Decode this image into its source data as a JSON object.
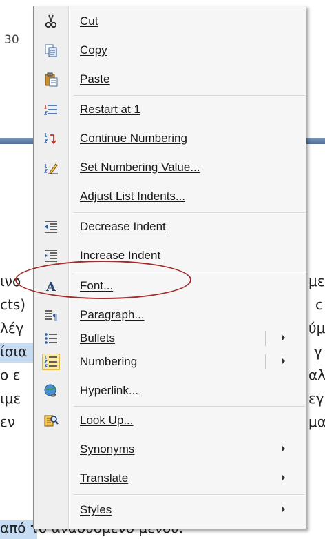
{
  "document": {
    "fragments": [
      {
        "id": "frag-30",
        "text": "30"
      },
      {
        "id": "frag-1",
        "text": "ινο"
      },
      {
        "id": "frag-2",
        "text": "cts)"
      },
      {
        "id": "frag-3",
        "text": "λέγ"
      },
      {
        "id": "frag-4",
        "text": "ίσια"
      },
      {
        "id": "frag-5",
        "text": "ο ε"
      },
      {
        "id": "frag-6",
        "text": "ιμε"
      },
      {
        "id": "frag-7",
        "text": "εν"
      },
      {
        "id": "frag-r1",
        "text": "με"
      },
      {
        "id": "frag-r2",
        "text": "c"
      },
      {
        "id": "frag-r3",
        "text": "ύμ"
      },
      {
        "id": "frag-r4",
        "text": "γ"
      },
      {
        "id": "frag-r5",
        "text": "αλ"
      },
      {
        "id": "frag-r6",
        "text": "εγ"
      },
      {
        "id": "frag-r7",
        "text": "μα"
      },
      {
        "id": "frag-bottom",
        "text": "από το αναδυόμενο μενού."
      }
    ]
  },
  "context_menu": {
    "items": [
      {
        "label": "Cut",
        "icon": "scissors-icon"
      },
      {
        "label": "Copy",
        "icon": "copy-icon"
      },
      {
        "label": "Paste",
        "icon": "paste-icon"
      },
      {
        "label": "Restart at 1",
        "icon": "restart-numbering-icon"
      },
      {
        "label": "Continue Numbering",
        "icon": "continue-numbering-icon"
      },
      {
        "label": "Set Numbering Value...",
        "icon": "set-numbering-value-icon"
      },
      {
        "label": "Adjust List Indents...",
        "icon": ""
      },
      {
        "label": "Decrease Indent",
        "icon": "decrease-indent-icon"
      },
      {
        "label": "Increase Indent",
        "icon": "increase-indent-icon"
      },
      {
        "label": "Font...",
        "icon": "font-icon"
      },
      {
        "label": "Paragraph...",
        "icon": "paragraph-icon"
      },
      {
        "label": "Bullets",
        "icon": "bullets-icon",
        "submenu": true
      },
      {
        "label": "Numbering",
        "icon": "numbering-icon",
        "submenu": true
      },
      {
        "label": "Hyperlink...",
        "icon": "hyperlink-icon"
      },
      {
        "label": "Look Up...",
        "icon": "look-up-icon"
      },
      {
        "label": "Synonyms",
        "icon": "",
        "submenu": true
      },
      {
        "label": "Translate",
        "icon": "",
        "submenu": true
      },
      {
        "label": "Styles",
        "icon": "",
        "submenu": true
      }
    ]
  },
  "colors": {
    "annotation_oval": "#a52a2a",
    "menu_background": "#f6f6f6",
    "gutter_background": "#efefef"
  }
}
